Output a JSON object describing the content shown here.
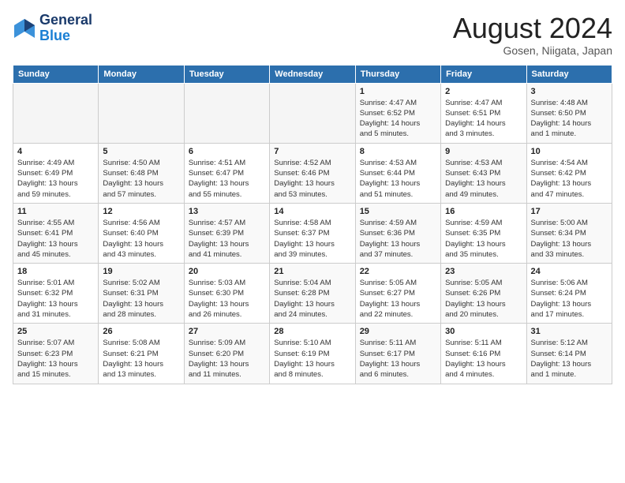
{
  "header": {
    "logo_line1": "General",
    "logo_line2": "Blue",
    "month": "August 2024",
    "location": "Gosen, Niigata, Japan"
  },
  "weekdays": [
    "Sunday",
    "Monday",
    "Tuesday",
    "Wednesday",
    "Thursday",
    "Friday",
    "Saturday"
  ],
  "weeks": [
    [
      {
        "day": "",
        "info": ""
      },
      {
        "day": "",
        "info": ""
      },
      {
        "day": "",
        "info": ""
      },
      {
        "day": "",
        "info": ""
      },
      {
        "day": "1",
        "info": "Sunrise: 4:47 AM\nSunset: 6:52 PM\nDaylight: 14 hours\nand 5 minutes."
      },
      {
        "day": "2",
        "info": "Sunrise: 4:47 AM\nSunset: 6:51 PM\nDaylight: 14 hours\nand 3 minutes."
      },
      {
        "day": "3",
        "info": "Sunrise: 4:48 AM\nSunset: 6:50 PM\nDaylight: 14 hours\nand 1 minute."
      }
    ],
    [
      {
        "day": "4",
        "info": "Sunrise: 4:49 AM\nSunset: 6:49 PM\nDaylight: 13 hours\nand 59 minutes."
      },
      {
        "day": "5",
        "info": "Sunrise: 4:50 AM\nSunset: 6:48 PM\nDaylight: 13 hours\nand 57 minutes."
      },
      {
        "day": "6",
        "info": "Sunrise: 4:51 AM\nSunset: 6:47 PM\nDaylight: 13 hours\nand 55 minutes."
      },
      {
        "day": "7",
        "info": "Sunrise: 4:52 AM\nSunset: 6:46 PM\nDaylight: 13 hours\nand 53 minutes."
      },
      {
        "day": "8",
        "info": "Sunrise: 4:53 AM\nSunset: 6:44 PM\nDaylight: 13 hours\nand 51 minutes."
      },
      {
        "day": "9",
        "info": "Sunrise: 4:53 AM\nSunset: 6:43 PM\nDaylight: 13 hours\nand 49 minutes."
      },
      {
        "day": "10",
        "info": "Sunrise: 4:54 AM\nSunset: 6:42 PM\nDaylight: 13 hours\nand 47 minutes."
      }
    ],
    [
      {
        "day": "11",
        "info": "Sunrise: 4:55 AM\nSunset: 6:41 PM\nDaylight: 13 hours\nand 45 minutes."
      },
      {
        "day": "12",
        "info": "Sunrise: 4:56 AM\nSunset: 6:40 PM\nDaylight: 13 hours\nand 43 minutes."
      },
      {
        "day": "13",
        "info": "Sunrise: 4:57 AM\nSunset: 6:39 PM\nDaylight: 13 hours\nand 41 minutes."
      },
      {
        "day": "14",
        "info": "Sunrise: 4:58 AM\nSunset: 6:37 PM\nDaylight: 13 hours\nand 39 minutes."
      },
      {
        "day": "15",
        "info": "Sunrise: 4:59 AM\nSunset: 6:36 PM\nDaylight: 13 hours\nand 37 minutes."
      },
      {
        "day": "16",
        "info": "Sunrise: 4:59 AM\nSunset: 6:35 PM\nDaylight: 13 hours\nand 35 minutes."
      },
      {
        "day": "17",
        "info": "Sunrise: 5:00 AM\nSunset: 6:34 PM\nDaylight: 13 hours\nand 33 minutes."
      }
    ],
    [
      {
        "day": "18",
        "info": "Sunrise: 5:01 AM\nSunset: 6:32 PM\nDaylight: 13 hours\nand 31 minutes."
      },
      {
        "day": "19",
        "info": "Sunrise: 5:02 AM\nSunset: 6:31 PM\nDaylight: 13 hours\nand 28 minutes."
      },
      {
        "day": "20",
        "info": "Sunrise: 5:03 AM\nSunset: 6:30 PM\nDaylight: 13 hours\nand 26 minutes."
      },
      {
        "day": "21",
        "info": "Sunrise: 5:04 AM\nSunset: 6:28 PM\nDaylight: 13 hours\nand 24 minutes."
      },
      {
        "day": "22",
        "info": "Sunrise: 5:05 AM\nSunset: 6:27 PM\nDaylight: 13 hours\nand 22 minutes."
      },
      {
        "day": "23",
        "info": "Sunrise: 5:05 AM\nSunset: 6:26 PM\nDaylight: 13 hours\nand 20 minutes."
      },
      {
        "day": "24",
        "info": "Sunrise: 5:06 AM\nSunset: 6:24 PM\nDaylight: 13 hours\nand 17 minutes."
      }
    ],
    [
      {
        "day": "25",
        "info": "Sunrise: 5:07 AM\nSunset: 6:23 PM\nDaylight: 13 hours\nand 15 minutes."
      },
      {
        "day": "26",
        "info": "Sunrise: 5:08 AM\nSunset: 6:21 PM\nDaylight: 13 hours\nand 13 minutes."
      },
      {
        "day": "27",
        "info": "Sunrise: 5:09 AM\nSunset: 6:20 PM\nDaylight: 13 hours\nand 11 minutes."
      },
      {
        "day": "28",
        "info": "Sunrise: 5:10 AM\nSunset: 6:19 PM\nDaylight: 13 hours\nand 8 minutes."
      },
      {
        "day": "29",
        "info": "Sunrise: 5:11 AM\nSunset: 6:17 PM\nDaylight: 13 hours\nand 6 minutes."
      },
      {
        "day": "30",
        "info": "Sunrise: 5:11 AM\nSunset: 6:16 PM\nDaylight: 13 hours\nand 4 minutes."
      },
      {
        "day": "31",
        "info": "Sunrise: 5:12 AM\nSunset: 6:14 PM\nDaylight: 13 hours\nand 1 minute."
      }
    ]
  ]
}
